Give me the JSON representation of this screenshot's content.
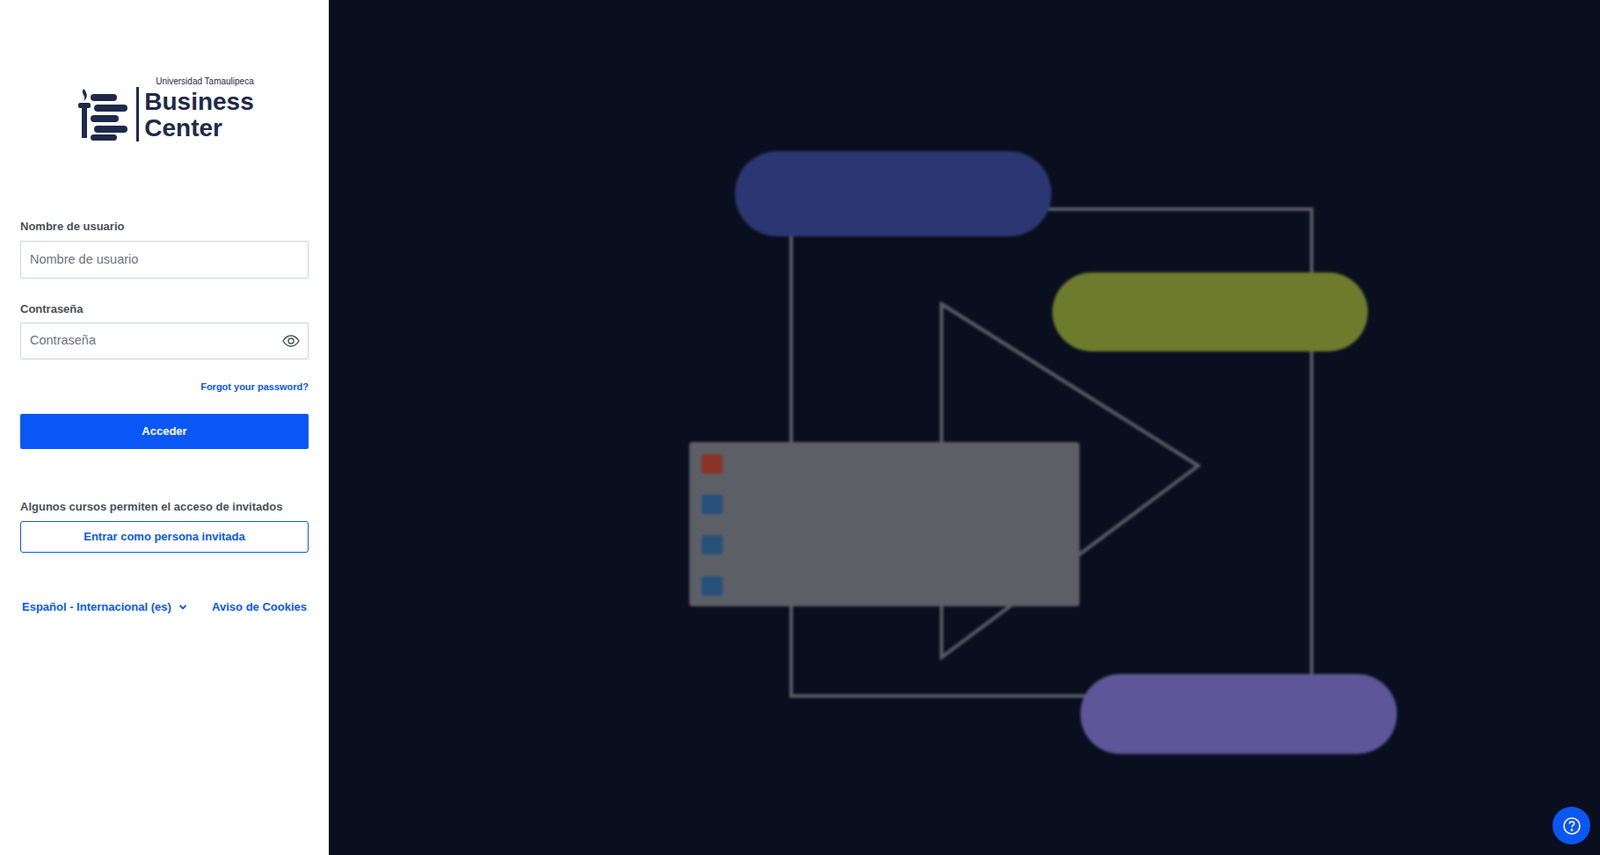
{
  "logo": {
    "institution": "Universidad Tamaulipeca",
    "line1": "Business",
    "line2": "Center"
  },
  "form": {
    "username": {
      "label": "Nombre de usuario",
      "placeholder": "Nombre de usuario"
    },
    "password": {
      "label": "Contraseña",
      "placeholder": "Contraseña"
    },
    "forgot": "Forgot your password?",
    "submit": "Acceder"
  },
  "guest": {
    "note": "Algunos cursos permiten el acceso de invitados",
    "button": "Entrar como persona invitada"
  },
  "footer": {
    "language": "Español - Internacional (es)",
    "cookies": "Aviso de Cookies"
  }
}
